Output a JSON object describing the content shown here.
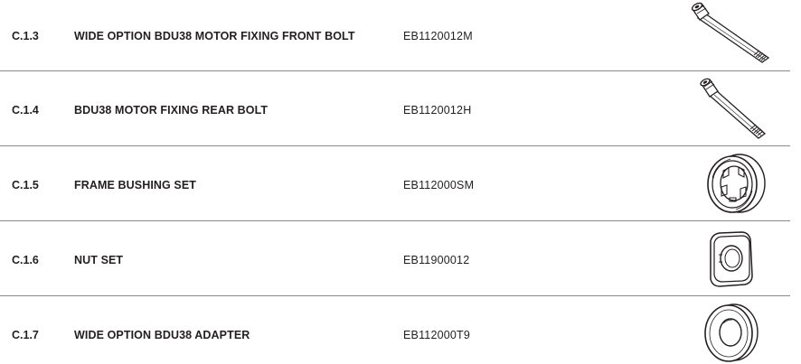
{
  "rows": [
    {
      "code": "C.1.3",
      "description": "WIDE OPTION BDU38 MOTOR FIXING FRONT BOLT",
      "part_number": "EB1120012M",
      "illustration": "long-bolt"
    },
    {
      "code": "C.1.4",
      "description": "BDU38 MOTOR FIXING REAR BOLT",
      "part_number": "EB1120012H",
      "illustration": "bolt"
    },
    {
      "code": "C.1.5",
      "description": "FRAME BUSHING SET",
      "part_number": "EB112000SM",
      "illustration": "bushing"
    },
    {
      "code": "C.1.6",
      "description": "NUT SET",
      "part_number": "EB11900012",
      "illustration": "nut"
    },
    {
      "code": "C.1.7",
      "description": "WIDE OPTION BDU38 ADAPTER",
      "part_number": "EB112000T9",
      "illustration": "adapter-ring"
    }
  ]
}
